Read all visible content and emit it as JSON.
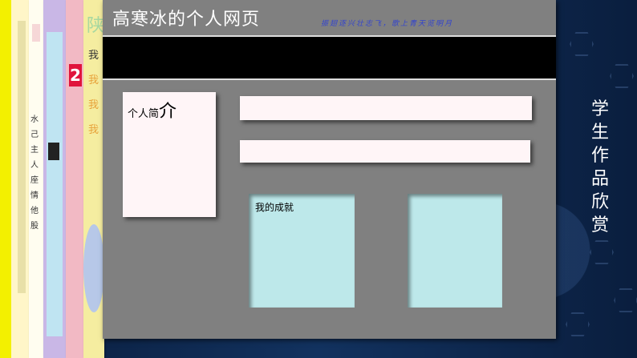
{
  "slide": {
    "side_caption_chars": [
      "学",
      "生",
      "作",
      "品",
      "欣",
      "赏"
    ]
  },
  "webpage": {
    "title": "高寒冰的个人网页",
    "slogan": "振翅逐兴壮志飞，歌上青天览明月",
    "intro_label_small": "个人简",
    "intro_label_big": "介",
    "achievement_label": "我的成就"
  },
  "thumbnails": {
    "chars_strip_a": [
      "水",
      "己",
      "主",
      "人",
      "座",
      "情",
      "他",
      "股"
    ],
    "chars_strip_b": [
      "我",
      "我",
      "我",
      "我"
    ],
    "digit": "2",
    "letter": "陕"
  },
  "colors": {
    "slide_bg": "#0b2347",
    "page_gray": "#808080",
    "nav_black": "#000000",
    "intro_bg": "#fff5f7",
    "achievement_bg": "#bde8ea",
    "slogan_blue": "#3344cc"
  }
}
